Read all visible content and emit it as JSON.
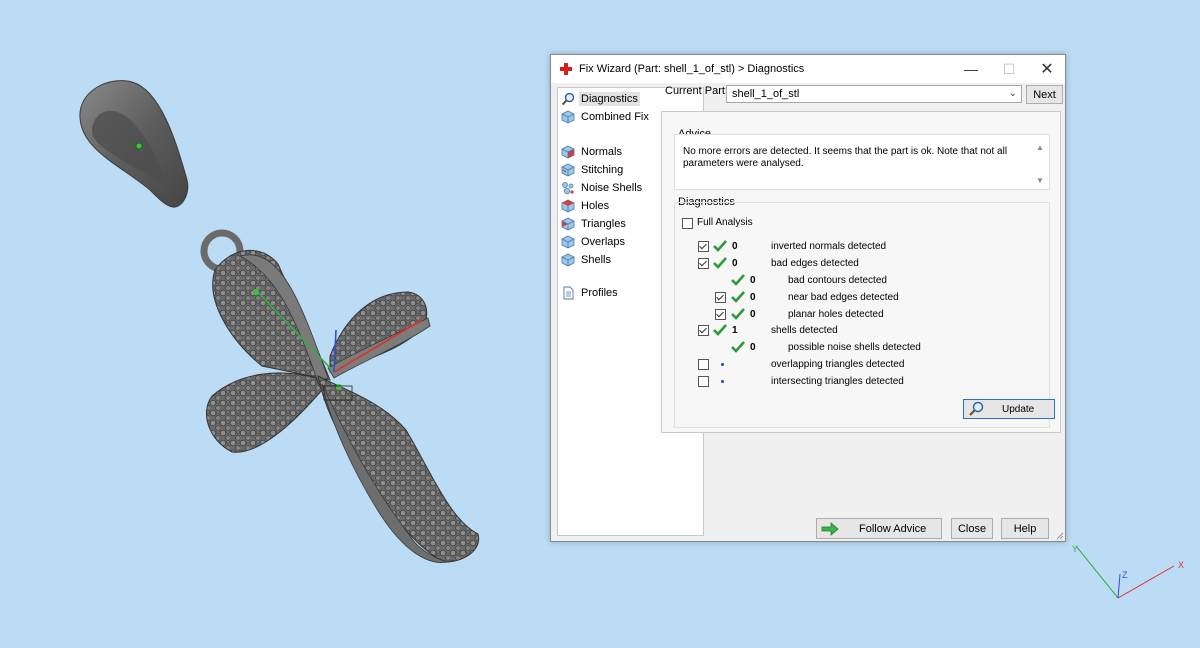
{
  "window": {
    "title": "Fix Wizard (Part: shell_1_of_stl) > Diagnostics",
    "icons": {
      "app": "red-cross-icon"
    }
  },
  "nav": {
    "items": [
      {
        "label": "Diagnostics",
        "icon": "magnifier-icon",
        "selected": true
      },
      {
        "label": "Combined Fix",
        "icon": "cube-icon"
      },
      {
        "label": "Normals",
        "icon": "normals-cube-icon"
      },
      {
        "label": "Stitching",
        "icon": "stitching-cube-icon"
      },
      {
        "label": "Noise Shells",
        "icon": "noise-shells-icon"
      },
      {
        "label": "Holes",
        "icon": "holes-cube-icon"
      },
      {
        "label": "Triangles",
        "icon": "triangles-cube-icon"
      },
      {
        "label": "Overlaps",
        "icon": "overlaps-cube-icon"
      },
      {
        "label": "Shells",
        "icon": "shells-cube-icon"
      },
      {
        "label": "Profiles",
        "icon": "document-icon"
      }
    ]
  },
  "current_part": {
    "label": "Current Part:",
    "value": "shell_1_of_stl",
    "next_label": "Next"
  },
  "advice": {
    "title": "Advice",
    "text": "No more errors are detected. It seems that the part is ok. Note that not all parameters were analysed."
  },
  "diagnostics": {
    "title": "Diagnostics",
    "full_analysis_label": "Full Analysis",
    "full_analysis_checked": false,
    "rows": [
      {
        "checkbox": true,
        "checked": true,
        "status": "ok",
        "count": "0",
        "label": "inverted normals detected"
      },
      {
        "checkbox": true,
        "checked": true,
        "status": "ok",
        "count": "0",
        "label": "bad edges detected"
      },
      {
        "checkbox": false,
        "status": "ok",
        "count": "0",
        "label": "bad contours detected"
      },
      {
        "checkbox": true,
        "checked": true,
        "status": "ok",
        "count": "0",
        "label": "near bad edges detected"
      },
      {
        "checkbox": true,
        "checked": true,
        "status": "ok",
        "count": "0",
        "label": "planar holes detected"
      },
      {
        "checkbox": true,
        "checked": true,
        "status": "ok",
        "count": "1",
        "label": "shells detected"
      },
      {
        "checkbox": false,
        "status": "ok",
        "count": "0",
        "label": "possible noise shells detected"
      },
      {
        "checkbox": true,
        "checked": false,
        "status": "none",
        "count": "",
        "label": "overlapping triangles detected"
      },
      {
        "checkbox": true,
        "checked": false,
        "status": "none",
        "count": "",
        "label": "intersecting triangles detected"
      }
    ],
    "update_label": "Update"
  },
  "footer": {
    "follow_advice_label": "Follow Advice",
    "close_label": "Close",
    "help_label": "Help"
  },
  "viewport": {
    "axis_labels": {
      "x": "X",
      "y": "Y",
      "z": "Z"
    },
    "colors": {
      "background": "#bcdcf5",
      "model": "#6e6e6e",
      "x_axis": "#e03030",
      "y_axis": "#30b040",
      "z_axis": "#3050d0"
    }
  }
}
